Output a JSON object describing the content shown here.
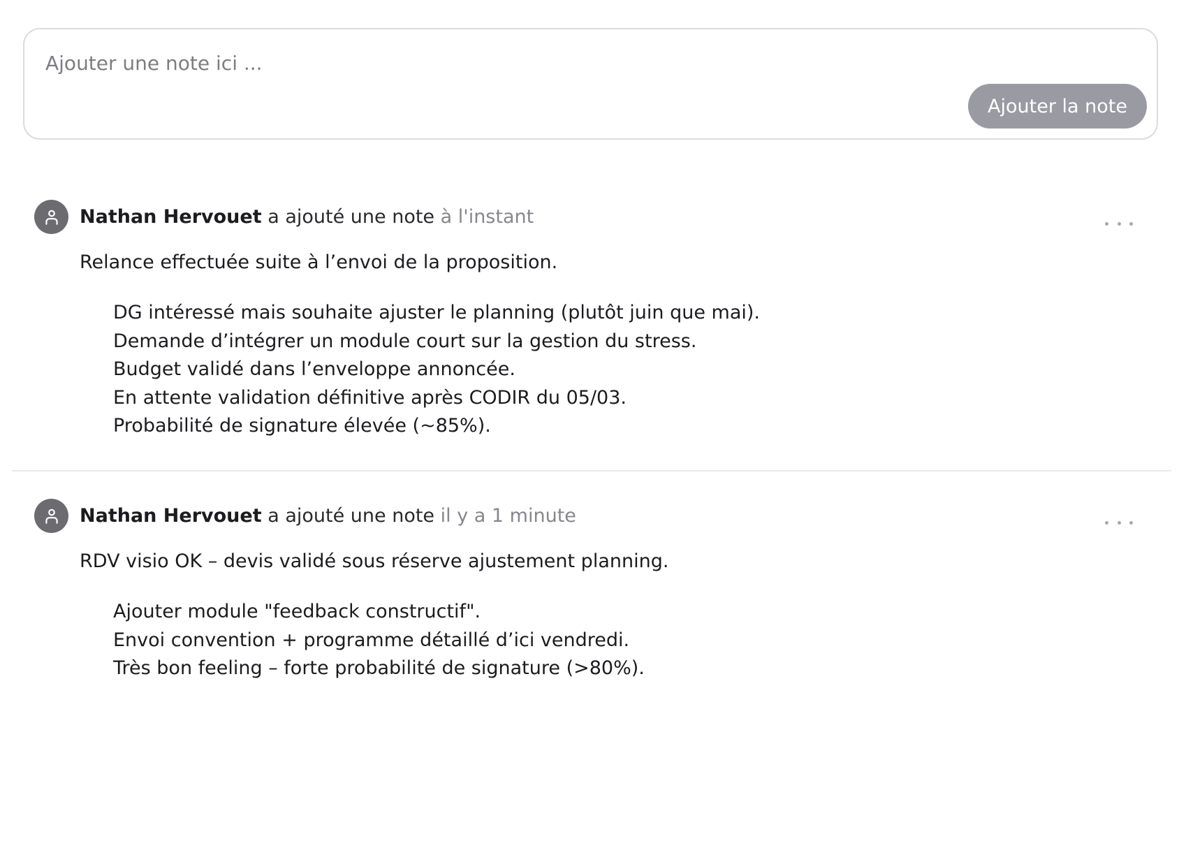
{
  "composer": {
    "placeholder": "Ajouter une note ici ...",
    "value": "",
    "submit_label": "Ajouter la note"
  },
  "notes": [
    {
      "author": "Nathan Hervouet",
      "action": "a ajouté une note",
      "time": "à l'instant",
      "summary": "Relance effectuée suite à l’envoi de la proposition.",
      "details": [
        "DG intéressé mais souhaite ajuster le planning (plutôt juin que mai).",
        "Demande d’intégrer un module court sur la gestion du stress.",
        "Budget validé dans l’enveloppe annoncée.",
        "En attente validation définitive après CODIR du 05/03.",
        "Probabilité de signature élevée (~85%)."
      ]
    },
    {
      "author": "Nathan Hervouet",
      "action": "a ajouté une note",
      "time": "il y a 1 minute",
      "summary": "RDV visio OK – devis validé sous réserve ajustement planning.",
      "details": [
        "Ajouter module \"feedback constructif\".",
        "Envoi convention + programme détaillé d’ici vendredi.",
        "Très bon feeling – forte probabilité de signature (>80%)."
      ]
    }
  ],
  "icons": {
    "avatar": "user-icon",
    "menu": "more-horizontal-icon"
  },
  "colors": {
    "button_bg": "#9a9aa3",
    "avatar_bg": "#6b6b70",
    "muted_text": "#86868c",
    "border": "#dcdce0"
  }
}
